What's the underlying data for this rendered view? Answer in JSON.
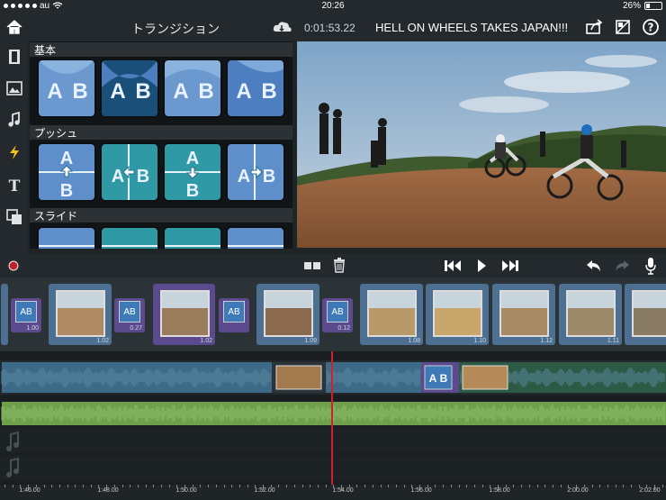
{
  "status_bar": {
    "carrier": "au",
    "time": "20:26",
    "battery": "26%",
    "battery_level": 0.26
  },
  "header": {
    "title": "トランジション",
    "timecode": "0:01:53.22",
    "project_name": "HELL ON WHEELS TAKES JAPAN!!!"
  },
  "panel": {
    "categories": [
      {
        "label": "基本",
        "letters": [
          "A",
          "B"
        ]
      },
      {
        "label": "プッシュ",
        "letters": [
          "A",
          "B"
        ]
      },
      {
        "label": "スライド",
        "letters": [
          "A",
          "B"
        ]
      }
    ]
  },
  "clips": {
    "durations": [
      "1.00",
      "1.02",
      "0.27",
      "1.02",
      "1.09",
      "0.12",
      "1.08",
      "1.10",
      "1.12",
      "1.11"
    ],
    "transition_letters": [
      "A",
      "B"
    ]
  },
  "ruler": {
    "labels": [
      "1:46.00",
      "1:48.00",
      "1:50.00",
      "1:52.00",
      "1:54.00",
      "1:56.00",
      "1:58.00",
      "2:00.00",
      "2:02.00"
    ]
  },
  "colors": {
    "accent_blue": "#4d6f91",
    "selection_purple": "#5c4a8e",
    "music_green": "#6ea04c",
    "record_red": "#c0202b",
    "playhead": "#d0202b"
  },
  "icons": {
    "titlebar": [
      "home-icon",
      "cloud-sync-icon",
      "share-icon",
      "settings-icon",
      "help-icon"
    ],
    "rail": [
      "film-icon",
      "photo-icon",
      "music-note-icon",
      "lightning-icon",
      "text-icon",
      "overlay-icon"
    ],
    "transport": [
      "record-icon",
      "split-icon",
      "trash-icon",
      "skip-back-icon",
      "play-icon",
      "skip-forward-icon",
      "undo-icon",
      "redo-icon",
      "microphone-icon"
    ]
  }
}
